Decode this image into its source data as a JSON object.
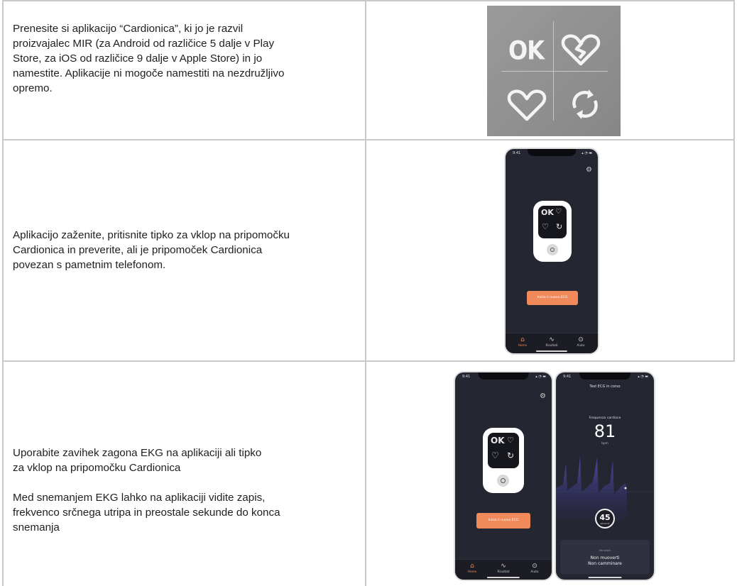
{
  "rows": [
    {
      "text_lines": [
        "Prenesite si aplikacijo “Cardionica”, ki jo je razvil",
        "proizvajalec MIR (za Android od različice 5 dalje v Play",
        "Store, za iOS od različice 9 dalje v Apple Store) in jo",
        "namestite. Aplikacije ni mogoče namestiti na nezdružljivo",
        "opremo."
      ]
    },
    {
      "text_lines": [
        "Aplikacijo zaženite, pritisnite tipko za vklop na pripomočku",
        "Cardionica in preverite, ali je pripomoček Cardionica",
        "povezan s pametnim telefonom."
      ]
    },
    {
      "text_lines_a": [
        "Uporabite zavihek zagona EKG na aplikaciji ali tipko",
        "za vklop na pripomočku Cardionica"
      ],
      "text_lines_b": [
        "Med snemanjem EKG lahko na aplikaciji vidite zapis,",
        "frekvenco srčnega utripa in preostale sekunde do konca",
        "snemanja"
      ]
    }
  ],
  "status_panel": {
    "ok_label": "OK",
    "icons": [
      "broken-heart-icon",
      "heart-icon",
      "refresh-icon"
    ],
    "background": "#8f8f8f",
    "foreground": "#f4f4f4"
  },
  "app": {
    "status_time": "9:41",
    "device_ok": "OK",
    "start_button_label": "Inizia il nuovo ECG",
    "tabs": [
      {
        "label": "Home",
        "icon": "home-icon",
        "active": true
      },
      {
        "label": "Risultati",
        "icon": "pulse-icon",
        "active": false
      },
      {
        "label": "Aiuto",
        "icon": "help-icon",
        "active": false
      }
    ],
    "accent": "#f08a5b",
    "ecg_screen": {
      "title": "Test ECG in corso",
      "hr_label": "Frequenza cardiaca",
      "heart_rate": "81",
      "unit": "bpm",
      "seconds_left": "45",
      "seconds_label": "secondi",
      "card_label": "Istruzioni",
      "message_line1": "Non muoverti",
      "message_line2": "Non camminare"
    }
  }
}
